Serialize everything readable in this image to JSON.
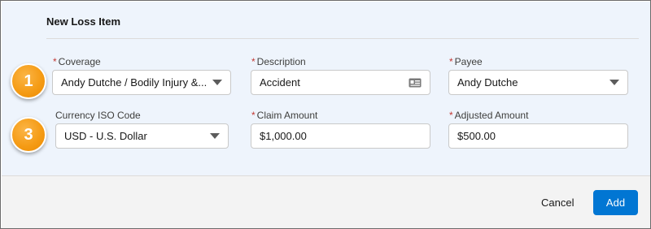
{
  "form": {
    "title": "New Loss Item",
    "required_marker": "*"
  },
  "callouts": [
    {
      "number": "1"
    },
    {
      "number": "3"
    }
  ],
  "fields": {
    "coverage": {
      "label": "Coverage",
      "required": true,
      "value": "Andy Dutche / Bodily Injury &...",
      "icon": "chevron-down-icon"
    },
    "description": {
      "label": "Description",
      "required": true,
      "value": "Accident",
      "icon": "card-icon"
    },
    "payee": {
      "label": "Payee",
      "required": true,
      "value": "Andy Dutche",
      "icon": "chevron-down-icon"
    },
    "currency": {
      "label": "Currency ISO Code",
      "required": false,
      "value": "USD - U.S. Dollar",
      "icon": "chevron-down-icon"
    },
    "claim_amount": {
      "label": "Claim Amount",
      "required": true,
      "value": "$1,000.00"
    },
    "adjusted_amount": {
      "label": "Adjusted Amount",
      "required": true,
      "value": "$500.00"
    }
  },
  "footer": {
    "cancel_label": "Cancel",
    "add_label": "Add"
  },
  "colors": {
    "panel_bg": "#eef4fc",
    "callout_orange": "#f59c16",
    "required_red": "#c23934",
    "brand_blue": "#0176d3"
  }
}
